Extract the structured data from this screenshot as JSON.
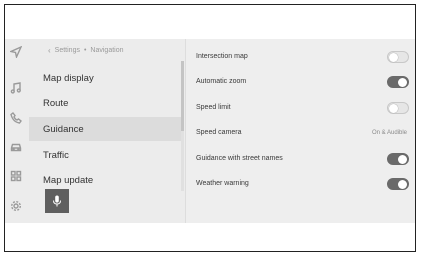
{
  "breadcrumb": {
    "back_icon": "chevron-left-icon",
    "parent": "Settings",
    "separator": "•",
    "current": "Navigation"
  },
  "rail_icons": [
    "navigation-arrow-icon",
    "music-note-icon",
    "phone-icon",
    "car-icon",
    "apps-grid-icon",
    "gear-icon"
  ],
  "menu": {
    "items": [
      {
        "label": "Map display",
        "selected": false
      },
      {
        "label": "Route",
        "selected": false
      },
      {
        "label": "Guidance",
        "selected": true
      },
      {
        "label": "Traffic",
        "selected": false
      },
      {
        "label": "Map update",
        "selected": false
      }
    ],
    "mic_icon": "microphone-icon"
  },
  "settings": {
    "rows": [
      {
        "label": "Intersection map",
        "type": "toggle",
        "state": "off"
      },
      {
        "label": "Automatic zoom",
        "type": "toggle",
        "state": "on"
      },
      {
        "label": "Speed limit",
        "type": "toggle",
        "state": "off"
      },
      {
        "label": "Speed camera",
        "type": "value",
        "value": "On & Audible"
      },
      {
        "label": "Guidance with street names",
        "type": "toggle",
        "state": "on"
      },
      {
        "label": "Weather warning",
        "type": "toggle",
        "state": "on"
      }
    ]
  },
  "colors": {
    "screen_bg": "#ececec",
    "selected_bg": "#dcdcdc",
    "toggle_on": "#6a6a6a",
    "toggle_off": "#e6e6e6",
    "mic_button": "#5f5f5f"
  }
}
